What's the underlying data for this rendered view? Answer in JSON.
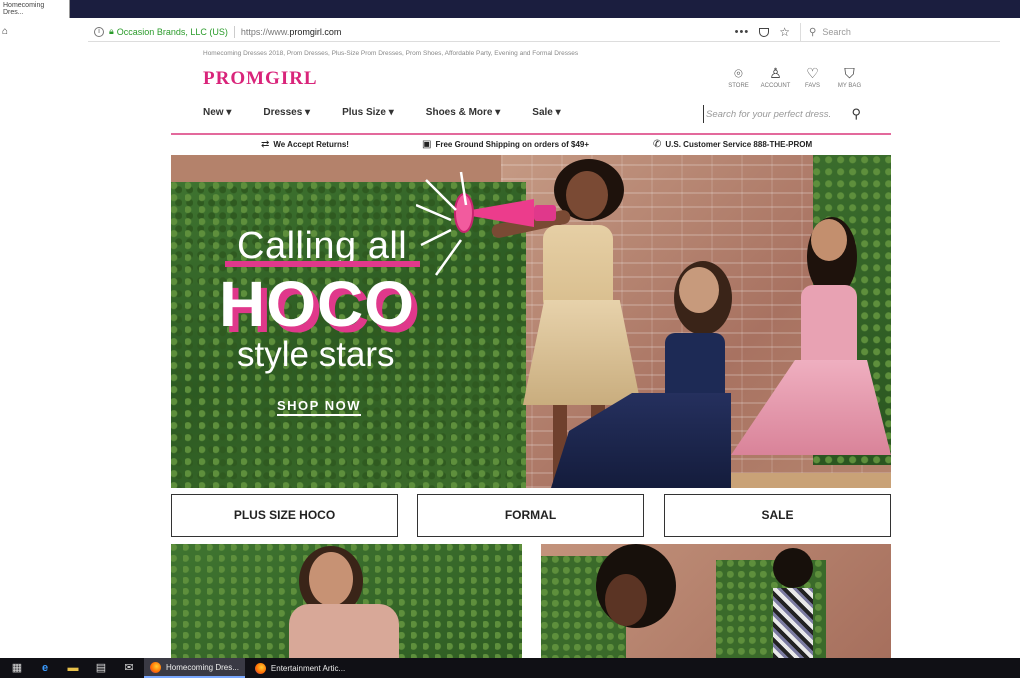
{
  "browser": {
    "tab_label": "Homecoming Dres...",
    "cert_owner": "Occasion Brands, LLC (US)",
    "url_prefix": "https://www.",
    "url_domain": "promgirl.com",
    "menu_dots": "•••",
    "search_placeholder": "Search"
  },
  "site": {
    "promo_text": "Homecoming Dresses 2018, Prom Dresses, Plus-Size Prom Dresses, Prom Shoes, Affordable Party, Evening and Formal Dresses",
    "logo": "PROMGIRL",
    "header_icons": [
      {
        "name": "store",
        "label": "STORE",
        "icon": "map-pin-icon"
      },
      {
        "name": "account",
        "label": "ACCOUNT",
        "icon": "person-icon"
      },
      {
        "name": "favs",
        "label": "FAVS",
        "icon": "heart-icon"
      },
      {
        "name": "bag",
        "label": "MY BAG",
        "icon": "bag-icon"
      }
    ],
    "nav": [
      "New ▾",
      "Dresses ▾",
      "Plus Size ▾",
      "Shoes & More ▾",
      "Sale ▾"
    ],
    "search_placeholder": "Search for your perfect dress.",
    "benefits": [
      {
        "label": "We Accept Returns!",
        "icon": "exchange-icon"
      },
      {
        "label": "Free Ground Shipping on orders of $49+",
        "icon": "gift-icon"
      },
      {
        "label": "U.S. Customer Service 888-THE-PROM",
        "icon": "phone-icon"
      }
    ]
  },
  "hero": {
    "line1": "Calling all",
    "line2": "HOCO",
    "line3": "style stars",
    "cta": "SHOP NOW"
  },
  "categories": [
    "PLUS SIZE HOCO",
    "FORMAL",
    "SALE"
  ],
  "taskbar": {
    "tasks": [
      "Homecoming Dres...",
      "Entertainment Artic..."
    ]
  },
  "colors": {
    "brand_pink": "#d9247a",
    "hero_pink": "#e0388b",
    "titlebar": "#1b1e3f",
    "taskbar": "#101015"
  }
}
